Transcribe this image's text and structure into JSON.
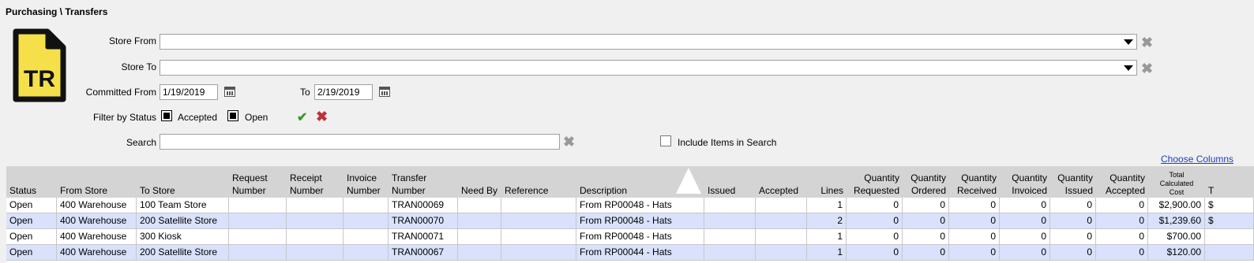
{
  "header": {
    "title": "Purchasing \\ Transfers"
  },
  "logo": {
    "text": "TR",
    "bg": "#f5e04a"
  },
  "filters": {
    "store_from_label": "Store From",
    "store_to_label": "Store To",
    "store_from_value": "",
    "store_to_value": "",
    "committed_from_label": "Committed From",
    "committed_from_value": "1/19/2019",
    "to_label": "To",
    "to_value": "2/19/2019",
    "filter_by_status_label": "Filter by Status",
    "status_accepted_label": "Accepted",
    "status_open_label": "Open",
    "search_label": "Search",
    "search_value": "",
    "include_items_label": "Include Items in Search",
    "clear_glyph": "✖",
    "apply_glyph": "✔"
  },
  "choose_columns": "Choose Columns",
  "columns": [
    "Status",
    "From Store",
    "To Store",
    "Request\nNumber",
    "Receipt\nNumber",
    "Invoice\nNumber",
    "Transfer\nNumber",
    "Need By",
    "Reference",
    "Description",
    "Issued",
    "Accepted",
    "Lines",
    "Quantity\nRequested",
    "Quantity\nOrdered",
    "Quantity\nReceived",
    "Quantity\nInvoiced",
    "Quantity\nIssued",
    "Quantity\nAccepted",
    "Total\nCalculated\nCost",
    "T"
  ],
  "rows": [
    {
      "status": "Open",
      "from": "400 Warehouse",
      "to": "100 Team Store",
      "req": "",
      "rec": "",
      "inv": "",
      "transfer": "TRAN00069",
      "needby": "",
      "ref": "",
      "desc": "From RP00048 - Hats",
      "issued": "",
      "accepted": "",
      "lines": "1",
      "qreq": "0",
      "qord": "0",
      "qrec": "0",
      "qinv": "0",
      "qiss": "0",
      "qacc": "0",
      "cost": "$2,900.00",
      "t": "$"
    },
    {
      "status": "Open",
      "from": "400 Warehouse",
      "to": "200 Satellite Store",
      "req": "",
      "rec": "",
      "inv": "",
      "transfer": "TRAN00070",
      "needby": "",
      "ref": "",
      "desc": "From RP00048 - Hats",
      "issued": "",
      "accepted": "",
      "lines": "2",
      "qreq": "0",
      "qord": "0",
      "qrec": "0",
      "qinv": "0",
      "qiss": "0",
      "qacc": "0",
      "cost": "$1,239.60",
      "t": "$"
    },
    {
      "status": "Open",
      "from": "400 Warehouse",
      "to": "300 Kiosk",
      "req": "",
      "rec": "",
      "inv": "",
      "transfer": "TRAN00071",
      "needby": "",
      "ref": "",
      "desc": "From RP00048 - Hats",
      "issued": "",
      "accepted": "",
      "lines": "1",
      "qreq": "0",
      "qord": "0",
      "qrec": "0",
      "qinv": "0",
      "qiss": "0",
      "qacc": "0",
      "cost": "$700.00",
      "t": ""
    },
    {
      "status": "Open",
      "from": "400 Warehouse",
      "to": "200 Satellite Store",
      "req": "",
      "rec": "",
      "inv": "",
      "transfer": "TRAN00067",
      "needby": "",
      "ref": "",
      "desc": "From RP00044 - Hats",
      "issued": "",
      "accepted": "",
      "lines": "1",
      "qreq": "0",
      "qord": "0",
      "qrec": "0",
      "qinv": "0",
      "qiss": "0",
      "qacc": "0",
      "cost": "$120.00",
      "t": ""
    }
  ]
}
